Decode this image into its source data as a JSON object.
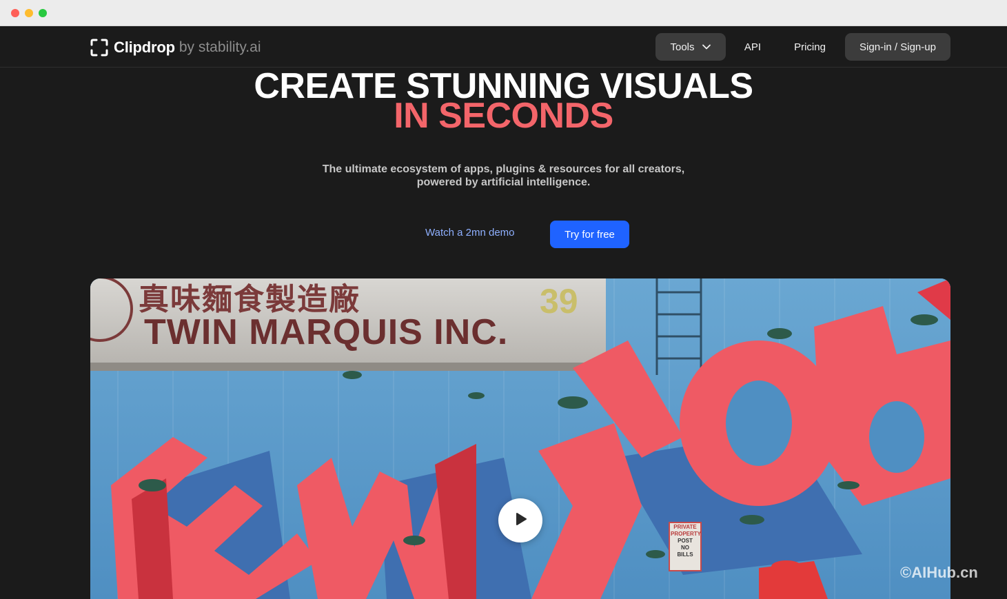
{
  "nav": {
    "brand": "Clipdrop",
    "by": "by stability.ai",
    "tools_label": "Tools",
    "api_label": "API",
    "pricing_label": "Pricing",
    "signin_label": "Sign-in / Sign-up"
  },
  "hero": {
    "title_line1": "CREATE STUNNING VISUALS",
    "title_line2": "IN SECONDS",
    "subtitle_line1": "The ultimate ecosystem of apps, plugins & resources for all creators,",
    "subtitle_line2": "powered by artificial intelligence.",
    "demo_label": "Watch a 2mn demo",
    "try_label": "Try for free"
  },
  "video": {
    "sign_text": "TWIN MARQUIS INC.",
    "sign_number": "39",
    "sign_chinese": "真味麵食製造廠",
    "poster_line1": "PRIVATE",
    "poster_line2": "PROPERTY",
    "poster_line3": "POST",
    "poster_line4": "NO",
    "poster_line5": "BILLS"
  },
  "watermark": "©AIHub.cn",
  "colors": {
    "accent_red": "#f3656a",
    "primary_blue": "#1f63ff",
    "link_blue": "#8fb0ff",
    "background": "#1b1b1b"
  }
}
